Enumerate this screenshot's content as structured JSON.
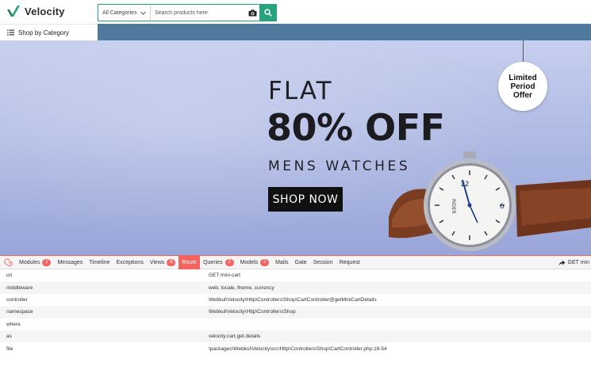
{
  "header": {
    "logo_text": "Velocity",
    "category_select": "All Categories",
    "search_placeholder": "Search products here"
  },
  "category_nav": {
    "label": "Shop by Category"
  },
  "banner": {
    "line1": "FLAT",
    "line2": "80% OFF",
    "line3": "MENS WATCHES",
    "cta": "SHOP NOW",
    "offer_line1": "Limited",
    "offer_line2": "Period",
    "offer_line3": "Offer",
    "watch_brand": "RIDER"
  },
  "debugbar": {
    "tabs": [
      {
        "label": "Modules",
        "badge": "1"
      },
      {
        "label": "Messages"
      },
      {
        "label": "Timeline"
      },
      {
        "label": "Exceptions"
      },
      {
        "label": "Views",
        "badge": "8"
      },
      {
        "label": "Route"
      },
      {
        "label": "Queries",
        "badge": "2"
      },
      {
        "label": "Models",
        "badge": "2"
      },
      {
        "label": "Mails"
      },
      {
        "label": "Gate"
      },
      {
        "label": "Session"
      },
      {
        "label": "Request"
      }
    ],
    "active_tab": "Route",
    "right_label": "GET min",
    "rows": [
      {
        "key": "uri",
        "value": "GET mini-cart"
      },
      {
        "key": "middleware",
        "value": "web, locale, theme, currency"
      },
      {
        "key": "controller",
        "value": "Webkul\\Velocity\\Http\\Controllers\\Shop\\CartController@getMiniCartDetails"
      },
      {
        "key": "namespace",
        "value": "Webkul\\Velocity\\Http\\Controllers\\Shop"
      },
      {
        "key": "where",
        "value": ""
      },
      {
        "key": "as",
        "value": "velocity.cart.get.details"
      },
      {
        "key": "file",
        "value": "\\packages\\Webkul\\Velocity\\src\\Http\\Controllers\\Shop\\CartController.php:18-54"
      }
    ]
  },
  "colors": {
    "brand_green": "#26a37c",
    "debug_red": "#f4645f",
    "nav_strip": "#4f7a9e"
  }
}
